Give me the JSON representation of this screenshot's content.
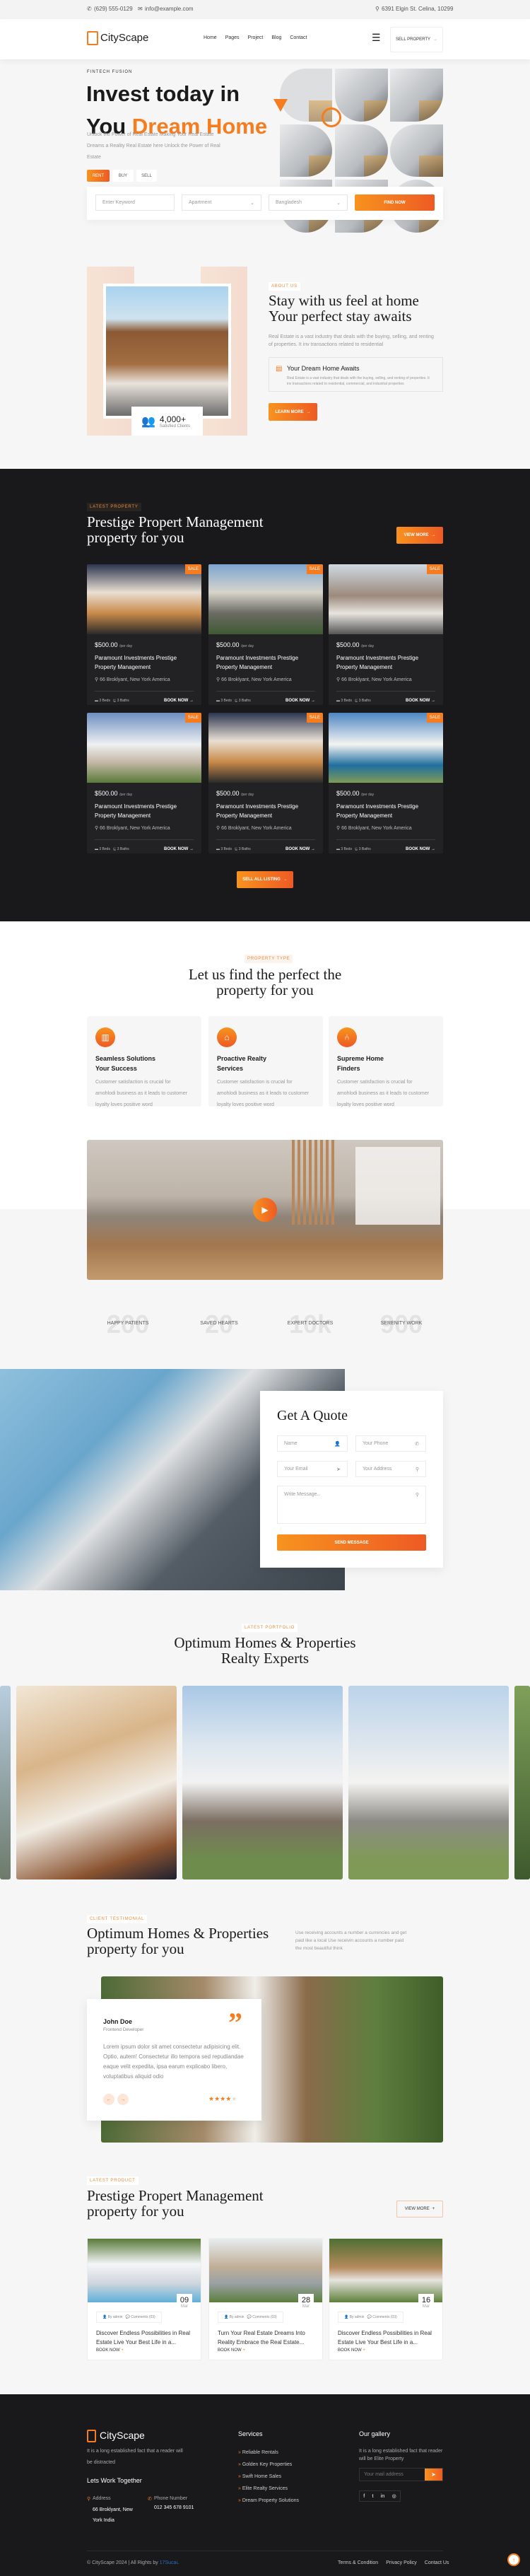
{
  "topbar": {
    "phone": "(629) 555-0129",
    "email": "info@example.com",
    "address": "6391 Elgin St. Celina, 10299"
  },
  "nav": {
    "brand": "CityScape",
    "links": [
      "Home",
      "Pages",
      "Project",
      "Blog",
      "Contact"
    ],
    "sell_label": "SELL PROPERTY"
  },
  "hero": {
    "eyebrow": "FINTECH FUSION",
    "title_line1": "Invest today in",
    "title_you": "You",
    "title_accent": "Dream Home",
    "desc": "Unlock the Power of Real Estate Making Your Real Estate Dreams a Reality Real Estate here Unlock the Power of Real Estate",
    "tabs": [
      "Rent",
      "Buy",
      "Sell"
    ],
    "active_tab": "Rent",
    "search": {
      "keyword_placeholder": "Enter Keyword",
      "type_value": "Apartment",
      "location_value": "Bangladesh",
      "button": "FIND NOW"
    }
  },
  "about": {
    "tag": "ABOUT US",
    "title": "Stay with us feel at home Your perfect stay awaits",
    "desc": "Real Estate is a vast industry that deals with the buying, selling, and renting of properties. It inv transactions related to residential",
    "feature_title": "Your Dream Home Awaits",
    "feature_desc": "Real Estate is a vast industry that deals with the buying, selling, and renting of properties. It inv transactions related to residential, commercial, and industrial properties",
    "stat_value": "4,000+",
    "stat_label": "Satisfied Clients",
    "button": "LEARN MORE"
  },
  "latest": {
    "tag": "LATEST PROPERTY",
    "title": "Prestige Propert Management property for you",
    "view_more": "VIEW MORE",
    "sell_all": "SELL ALL LISTING",
    "cards": [
      {
        "badge": "SALE",
        "price": "$500.00",
        "unit": "/per day",
        "title": "Paramount Investments Prestige Property Management",
        "location": "66 Broklyant, New York America",
        "beds": "3 Beds",
        "baths": "3 Baths",
        "cta": "BOOK NOW"
      },
      {
        "badge": "SALE",
        "price": "$500.00",
        "unit": "/per day",
        "title": "Paramount Investments Prestige Property Management",
        "location": "66 Broklyant, New York America",
        "beds": "3 Beds",
        "baths": "3 Baths",
        "cta": "BOOK NOW"
      },
      {
        "badge": "SALE",
        "price": "$500.00",
        "unit": "/per day",
        "title": "Paramount Investments Prestige Property Management",
        "location": "66 Broklyant, New York America",
        "beds": "3 Beds",
        "baths": "3 Baths",
        "cta": "BOOK NOW"
      },
      {
        "badge": "SALE",
        "price": "$500.00",
        "unit": "/per day",
        "title": "Paramount Investments Prestige Property Management",
        "location": "66 Broklyant, New York America",
        "beds": "3 Beds",
        "baths": "3 Baths",
        "cta": "BOOK NOW"
      },
      {
        "badge": "SALE",
        "price": "$500.00",
        "unit": "/per day",
        "title": "Paramount Investments Prestige Property Management",
        "location": "66 Broklyant, New York America",
        "beds": "3 Beds",
        "baths": "3 Baths",
        "cta": "BOOK NOW"
      },
      {
        "badge": "SALE",
        "price": "$500.00",
        "unit": "/per day",
        "title": "Paramount Investments Prestige Property Management",
        "location": "66 Broklyant, New York America",
        "beds": "3 Beds",
        "baths": "3 Baths",
        "cta": "BOOK NOW"
      }
    ]
  },
  "ptype": {
    "tag": "PROPERTY TYPE",
    "title": "Let us find the perfect the property for you",
    "cards": [
      {
        "icon": "building-icon",
        "title": "Seamless Solutions Your Success",
        "desc": "Customer satisfaction is crucial for amohlodi business as it leads to customer loyalty loves positive word"
      },
      {
        "icon": "house-icon",
        "title": "Proactive Realty Services",
        "desc": "Customer satisfaction is crucial for amohlodi business as it leads to customer loyalty loves positive word"
      },
      {
        "icon": "armchair-icon",
        "title": "Supreme Home Finders",
        "desc": "Customer satisfaction is crucial for amohlodi business as it leads to customer loyalty loves positive word"
      }
    ]
  },
  "stats": [
    {
      "value": "200",
      "label": "HAPPY PATIENTS"
    },
    {
      "value": "20",
      "label": "SAVED HEARTS"
    },
    {
      "value": "10k",
      "label": "EXPERT DOCTORS"
    },
    {
      "value": "900",
      "label": "SERENITY WORK"
    }
  ],
  "quote": {
    "title": "Get A Quote",
    "name": "Name",
    "phone": "Your Phone",
    "email": "Your Email",
    "address": "Your Address",
    "message": "Write Message..",
    "button": "SEND MESSAGE"
  },
  "portfolio": {
    "tag": "LATEST PORTFOLIO",
    "title": "Optimum Homes & Properties Realty Experts"
  },
  "testimonial": {
    "tag": "CLIENT TESTIMONIAL",
    "title": "Optimum Homes & Properties property for you",
    "side_text": "Use receiving accounts a number a currencies and get paid like a local Use receivin accounts a number paid the most beautiful think",
    "name": "John Doe",
    "role": "Frontend Developer",
    "text": "Lorem ipsum dolor sit amet consectetur adipisicing elit. Optio, autem! Consectetur illo tempora sed repudiandae eaque velit expedita, ipsa earum explicabo libero, voluptatibus aliquid odio",
    "rating": 4,
    "rating_max": 5
  },
  "blog": {
    "tag": "LATEST PRODUCT",
    "title": "Prestige Propert Management property for you",
    "view_more": "VIEW MORE",
    "posts": [
      {
        "day": "09",
        "month": "Mar",
        "author": "By admin",
        "comments": "Comments (03)",
        "title": "Discover Endless Possibilities in Real Estate Live Your Best Life in a...",
        "cta": "BOOK NOW"
      },
      {
        "day": "28",
        "month": "Mar",
        "author": "By admin",
        "comments": "Comments (03)",
        "title": "Turn Your Real Estate Dreams Into Reality Embrace the Real Estate...",
        "cta": "BOOK NOW"
      },
      {
        "day": "16",
        "month": "Mar",
        "author": "By admin",
        "comments": "Comments (03)",
        "title": "Discover Endless Possibilities in Real Estate Live Your Best Life in a...",
        "cta": "BOOK NOW"
      }
    ]
  },
  "footer": {
    "brand": "CityScape",
    "desc": "It is a long established fact that a reader will be distracted",
    "work_title": "Lets Work Together",
    "address_label": "Address",
    "address": "66 Broklyant, New York India",
    "phone_label": "Phone Number",
    "phone": "012 345 678 9101",
    "services_title": "Services",
    "services": [
      "Reliable Rentals",
      "Golden Key Properties",
      "Swift Home Sales",
      "Elite Realty Services",
      "Dream Property Solutions"
    ],
    "gallery_title": "Our gallery",
    "gallery_desc": "It is a long established fact that reader will be Elite Property",
    "email_placeholder": "Your mail address",
    "copyright": "© CityScape 2024 | All Rights by",
    "copyright_link": "17Sucai",
    "legal": [
      "Terms & Condition",
      "Privacy Policy",
      "Contact Us"
    ]
  },
  "colors": {
    "accent": "#f57c1f",
    "accent_end": "#ee5a24",
    "dark": "#19181a"
  }
}
